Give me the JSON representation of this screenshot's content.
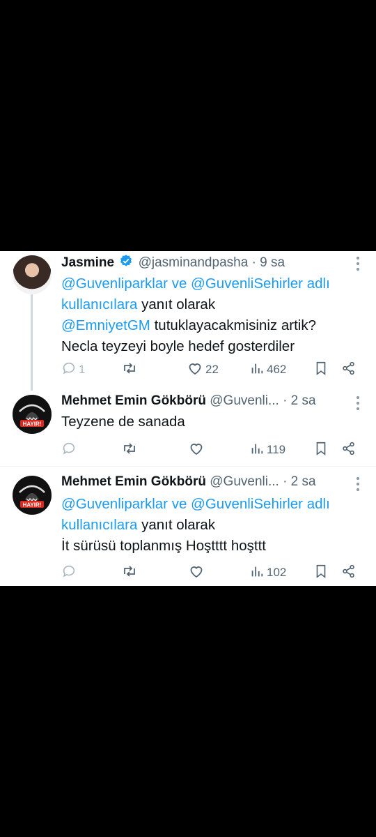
{
  "tweets": [
    {
      "name": "Jasmine",
      "verified": true,
      "handle": "@jasminandpasha",
      "time": "· 9 sa",
      "reply_mention1": "@Guvenliparklar",
      "reply_ve": "ve",
      "reply_mention2": "@GuvenliSehirler",
      "reply_adli": "adlı",
      "reply_kullanici": "kullanıcılara",
      "reply_suffix": "yanıt olarak",
      "body_mention": "@EmniyetGM",
      "body_text1": "tutuklayacakmisiniz artik?",
      "body_text2": "Necla teyzeyi boyle hedef gosterdiler",
      "replies": "1",
      "likes": "22",
      "views": "462"
    },
    {
      "name": "Mehmet Emin Gökbörü",
      "handle": "@Guvenli...",
      "time": "· 2 sa",
      "body_text": "Teyzene de sanada",
      "views": "119"
    },
    {
      "name": "Mehmet Emin Gökbörü",
      "handle": "@Guvenli...",
      "time": "· 2 sa",
      "reply_mention1": "@Guvenliparklar",
      "reply_ve": "ve",
      "reply_mention2": "@GuvenliSehirler",
      "reply_adli": "adlı",
      "reply_kullanici": "kullanıcılara",
      "reply_suffix": "yanıt olarak",
      "body_text": "İt sürüsü toplanmış Hoştttt hoşttt",
      "views": "102"
    }
  ],
  "avatar_badge_text": "HAYIR!",
  "colors": {
    "link": "#1d9bf0",
    "muted": "#536471",
    "verified": "#1d9bf0",
    "badge": "#e0251b"
  }
}
